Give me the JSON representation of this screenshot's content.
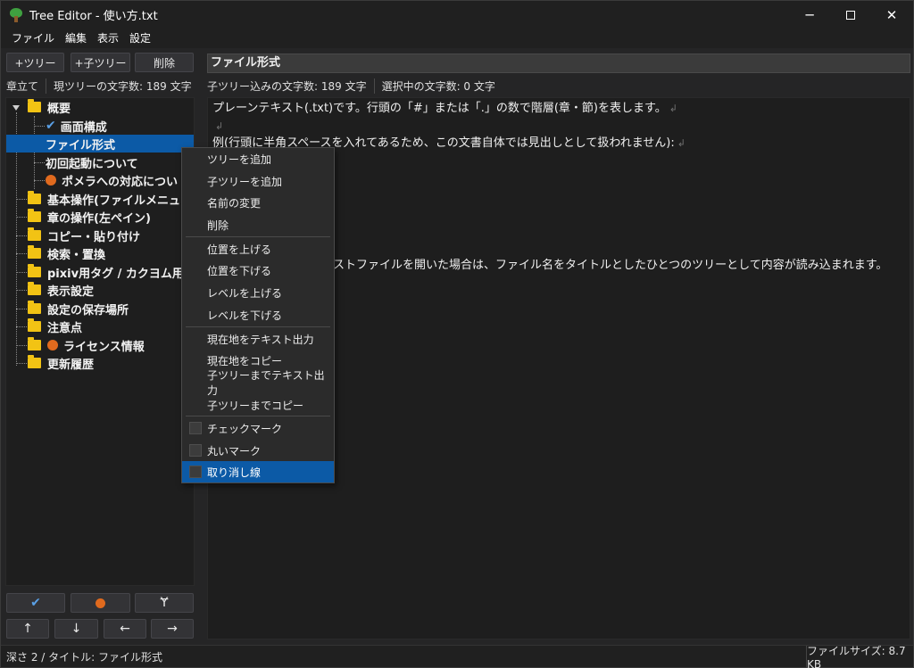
{
  "window": {
    "title": "Tree Editor - 使い方.txt",
    "controls": {
      "minimize": "─",
      "close": "✕"
    }
  },
  "menu": [
    "ファイル",
    "編集",
    "表示",
    "設定"
  ],
  "toolbar": {
    "add_tree": "+ツリー",
    "add_child": "+子ツリー",
    "delete": "削除"
  },
  "left_status": {
    "mode": "章立て",
    "current_count": "現ツリーの文字数: 189 文字"
  },
  "tree": {
    "nodes": [
      {
        "label": "概要"
      },
      {
        "label": "画面構成",
        "check": "✔"
      },
      {
        "label": "ファイル形式"
      },
      {
        "label": "初回起動について"
      },
      {
        "label": "ポメラへの対応につい"
      },
      {
        "label": "基本操作(ファイルメニュ"
      },
      {
        "label": "章の操作(左ペイン)"
      },
      {
        "label": "コピー・貼り付け"
      },
      {
        "label": "検索・置換"
      },
      {
        "label": "pixiv用タグ / カクヨム用・"
      },
      {
        "label": "表示設定"
      },
      {
        "label": "設定の保存場所"
      },
      {
        "label": "注意点"
      },
      {
        "label": "ライセンス情報"
      },
      {
        "label": "更新履歴"
      }
    ]
  },
  "bottom_buttons": {
    "check": "✔",
    "strike": "Ɏ",
    "up": "↑",
    "down": "↓",
    "left": "←",
    "right": "→"
  },
  "right": {
    "title_value": "ファイル形式",
    "status_child": "子ツリー込みの文字数: 189 文字",
    "status_selected": "選択中の文字数: 0 文字",
    "lines": [
      "プレーンテキスト(.txt)です。行頭の「#」または「.」の数で階層(章・節)を表します。",
      "",
      "例(行頭に半角スペースを入れてあるため、この文書自体では見出しとして扱われません):",
      "ストファイルを開いた場合は、ファイル名をタイトルとしたひとつのツリーとして内容が読み込まれます。"
    ],
    "return_mark": "↲"
  },
  "context_menu": {
    "items": [
      "ツリーを追加",
      "子ツリーを追加",
      "名前の変更",
      "削除",
      "位置を上げる",
      "位置を下げる",
      "レベルを上げる",
      "レベルを下げる",
      "現在地をテキスト出力",
      "現在地をコピー",
      "子ツリーまでテキスト出力",
      "子ツリーまでコピー",
      "チェックマーク",
      "丸いマーク",
      "取り消し線"
    ]
  },
  "statusbar": {
    "left": "深さ 2 / タイトル: ファイル形式",
    "right": "ファイルサイズ: 8.7 KB"
  },
  "colors": {
    "selection": "#0c5aa6",
    "folder": "#f2c314",
    "circle_mark": "#e06a1e",
    "check_mark": "#5aa0e6"
  }
}
